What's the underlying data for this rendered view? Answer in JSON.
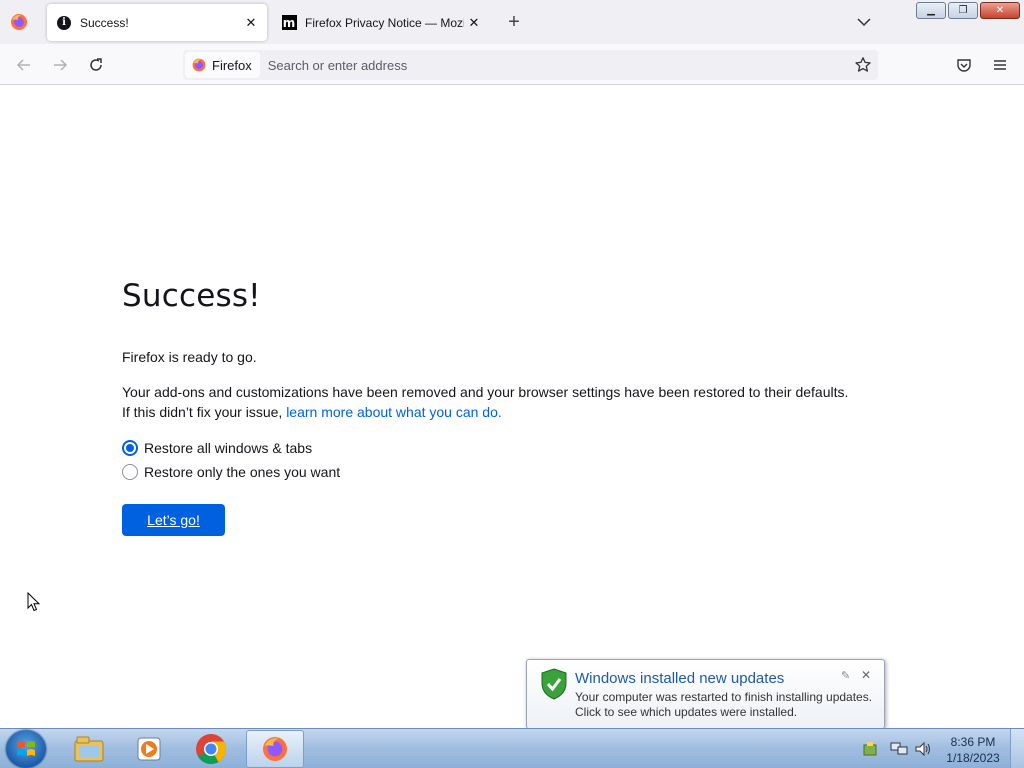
{
  "browser": {
    "tabs": [
      {
        "title": "Success!",
        "icon": "info-icon",
        "active": true
      },
      {
        "title": "Firefox Privacy Notice — Mozilla",
        "icon": "mozilla-icon",
        "active": false
      }
    ],
    "identity_label": "Firefox",
    "address_placeholder": "Search or enter address"
  },
  "page": {
    "heading": "Success!",
    "ready_text": "Firefox is ready to go.",
    "description": "Your add-ons and customizations have been removed and your browser settings have been restored to their defaults.",
    "issue_prefix": "If this didn’t fix your issue,",
    "learn_more_link": "learn more about what you can do.",
    "options": [
      {
        "label": "Restore all windows & tabs",
        "checked": true
      },
      {
        "label": "Restore only the ones you want",
        "checked": false
      }
    ],
    "go_button": "Let’s go!"
  },
  "notification": {
    "title": "Windows installed new updates",
    "line1": "Your computer was restarted to finish installing updates.",
    "line2": "Click to see which updates were installed."
  },
  "taskbar": {
    "time": "8:36 PM",
    "date": "1/18/2023"
  },
  "colors": {
    "accent": "#0061e0",
    "tab_strip": "#f0f0f4",
    "link": "#0061e0"
  }
}
